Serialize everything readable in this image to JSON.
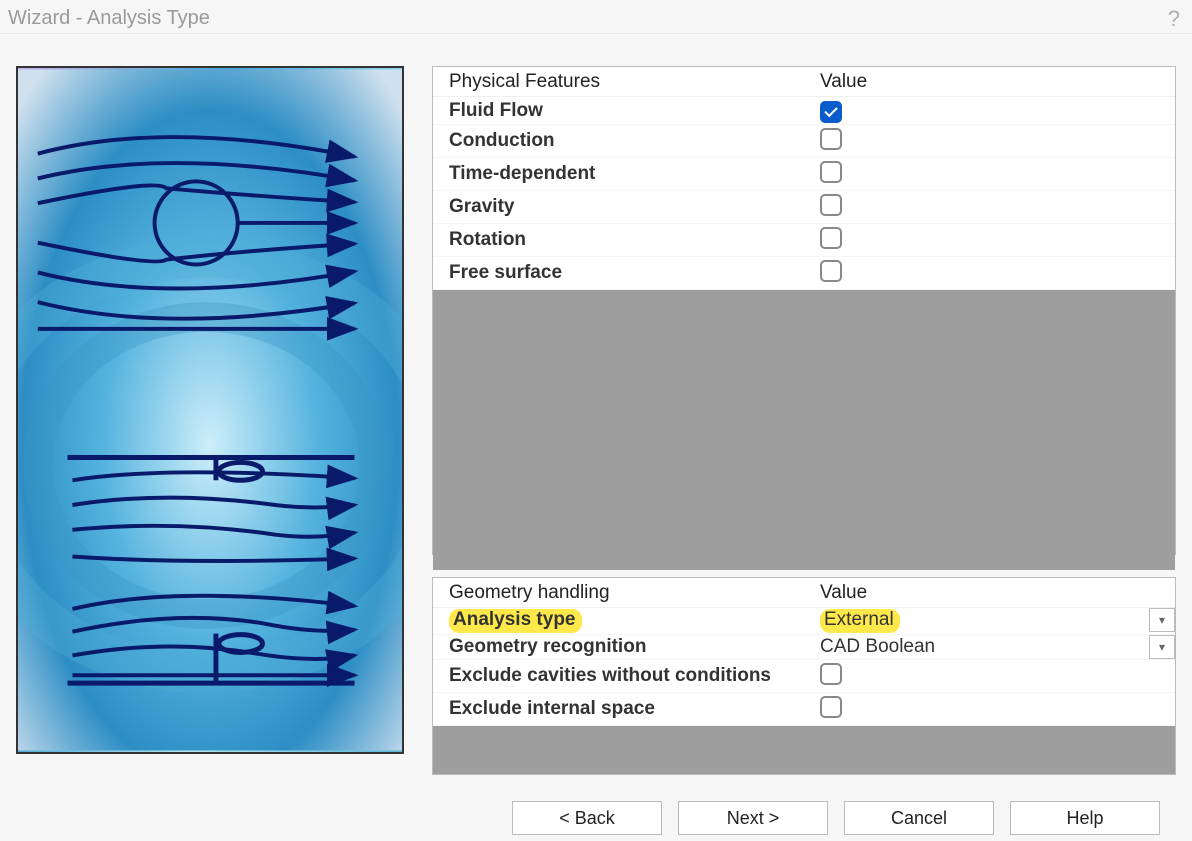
{
  "title": "Wizard - Analysis Type",
  "physical": {
    "header_feature": "Physical Features",
    "header_value": "Value",
    "rows": [
      {
        "label": "Fluid Flow",
        "checked": true
      },
      {
        "label": "Conduction",
        "checked": false
      },
      {
        "label": "Time-dependent",
        "checked": false
      },
      {
        "label": "Gravity",
        "checked": false
      },
      {
        "label": "Rotation",
        "checked": false
      },
      {
        "label": "Free surface",
        "checked": false
      }
    ]
  },
  "geometry": {
    "header_feature": "Geometry handling",
    "header_value": "Value",
    "rows": [
      {
        "label": "Analysis type",
        "value": "External",
        "highlight": true,
        "dropdown": true,
        "checkbox": false
      },
      {
        "label": "Geometry recognition",
        "value": "CAD Boolean",
        "highlight": false,
        "dropdown": true,
        "checkbox": false
      },
      {
        "label": "Exclude cavities without conditions",
        "value": "",
        "highlight": false,
        "dropdown": false,
        "checkbox": true,
        "checked": false
      },
      {
        "label": "Exclude internal space",
        "value": "",
        "highlight": false,
        "dropdown": false,
        "checkbox": true,
        "checked": false
      }
    ]
  },
  "buttons": {
    "back": "< Back",
    "next": "Next >",
    "cancel": "Cancel",
    "help": "Help"
  }
}
